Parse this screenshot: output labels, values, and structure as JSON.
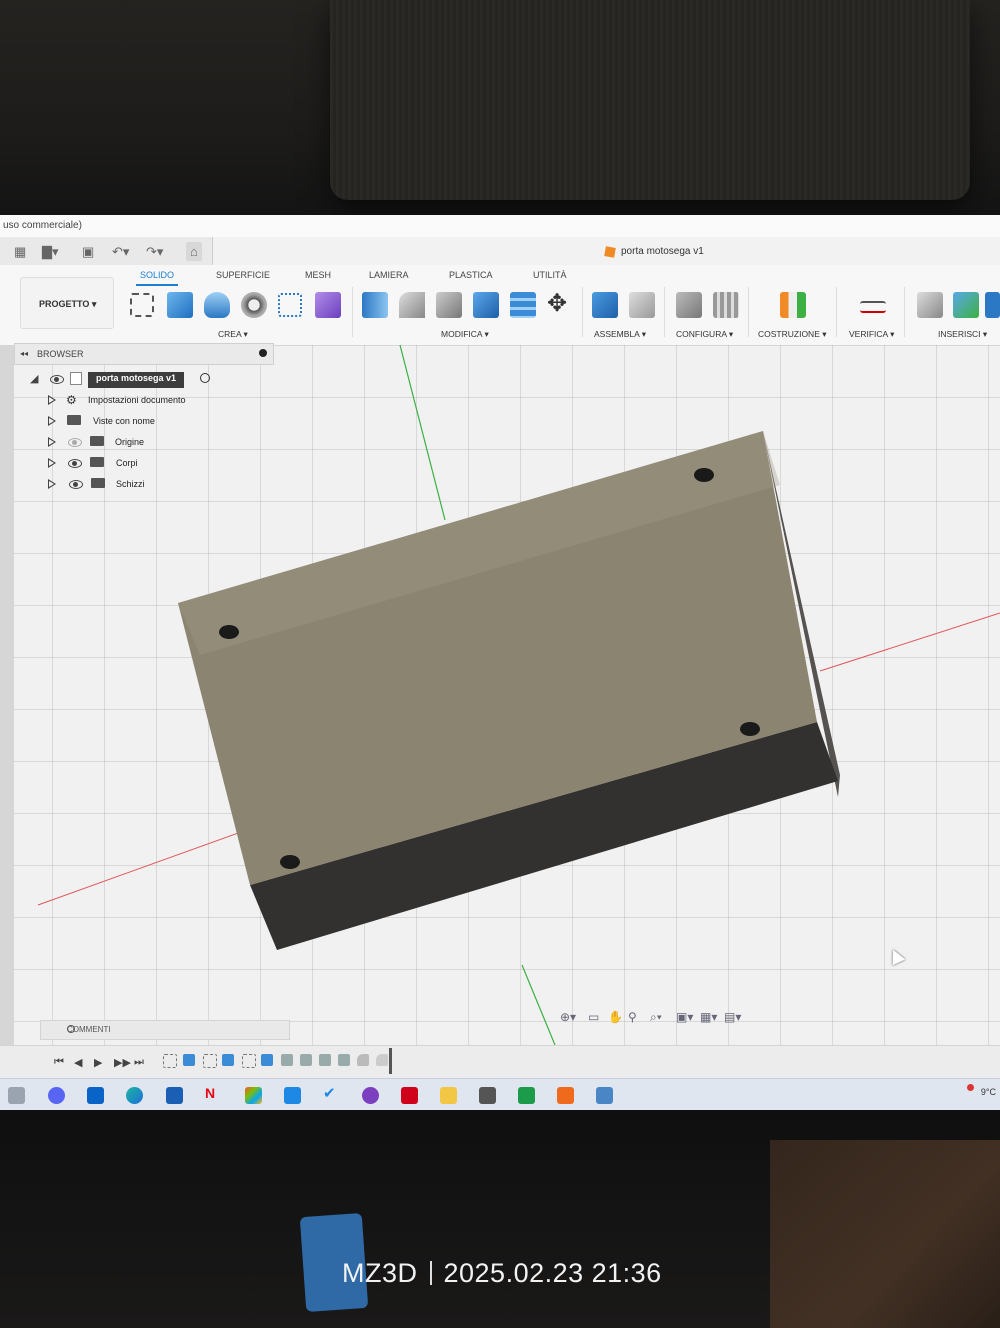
{
  "window": {
    "title_fragment": "uso commerciale)",
    "document_tab": "porta motosega v1"
  },
  "ribbon": {
    "tabs": [
      "SOLIDO",
      "SUPERFICIE",
      "MESH",
      "LAMIERA",
      "PLASTICA",
      "UTILITÀ"
    ],
    "active_tab": "SOLIDO",
    "project_button": "PROGETTO ▾",
    "groups": [
      "CREA ▾",
      "MODIFICA ▾",
      "ASSEMBLA ▾",
      "CONFIGURA ▾",
      "COSTRUZIONE ▾",
      "VERIFICA ▾",
      "INSERISCI ▾"
    ]
  },
  "browser": {
    "title": "BROWSER",
    "root": "porta motosega v1",
    "items": [
      {
        "label": "Impostazioni documento",
        "icon": "gear-icon"
      },
      {
        "label": "Viste con nome",
        "icon": "folder-icon"
      },
      {
        "label": "Origine",
        "icon": "folder-icon",
        "visibility": "hidden"
      },
      {
        "label": "Corpi",
        "icon": "folder-icon",
        "visibility": "visible"
      },
      {
        "label": "Schizzi",
        "icon": "folder-icon",
        "visibility": "visible"
      }
    ]
  },
  "comments": {
    "label": "COMMENTI"
  },
  "taskbar": {
    "temperature": "9°C"
  },
  "watermark": {
    "brand": "MZ3D",
    "timestamp": "2025.02.23 21:36"
  },
  "colors": {
    "accent": "#1e7fd0",
    "model_top": "#8b8470",
    "model_side": "#333130",
    "axis_green": "#3cb043",
    "axis_red": "#e0565b"
  }
}
